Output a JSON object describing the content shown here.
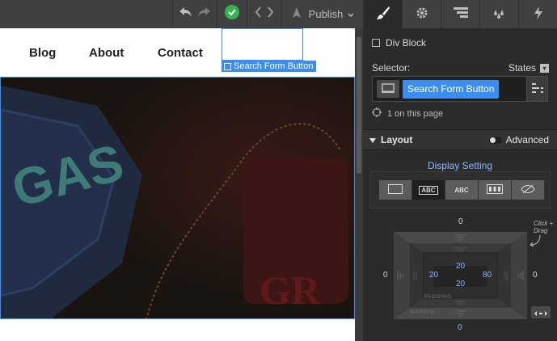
{
  "toolbar": {
    "publish_label": "Publish"
  },
  "panel_tabs": [
    "style-brush-icon",
    "settings-gear-icon",
    "navigator-icon",
    "interactions-drops-icon",
    "lightning-icon"
  ],
  "nav": {
    "links": [
      "Blog",
      "About",
      "Contact"
    ]
  },
  "selection": {
    "tag_label": "Search Form Button"
  },
  "panel": {
    "element_type": "Div Block",
    "selector_label": "Selector:",
    "states_label": "States",
    "selector_chip": "Search Form Button",
    "on_page": "1 on this page",
    "layout_title": "Layout",
    "advanced_label": "Advanced",
    "display_setting": "Display Setting",
    "display_buttons": [
      "",
      "ABC",
      "ABC",
      "",
      ""
    ],
    "click_drag": "Click + Drag",
    "box": {
      "margin_top": "0",
      "margin_bottom": "0",
      "margin_left": "0",
      "margin_right": "0",
      "padding_top": "20",
      "padding_bottom": "20",
      "padding_left": "20",
      "padding_right": "80",
      "padding_label": "PADDING",
      "margin_label": "MARGIN"
    }
  },
  "colors": {
    "accent": "#3b8ef0",
    "success": "#37b24d",
    "link_blue": "#8ab8ff"
  }
}
